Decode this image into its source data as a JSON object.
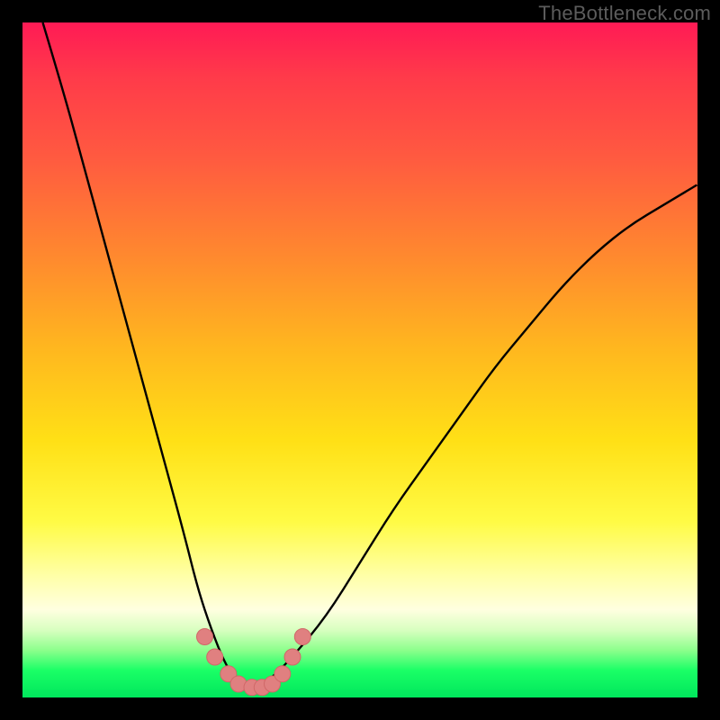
{
  "watermark": "TheBottleneck.com",
  "colors": {
    "frame": "#000000",
    "curve": "#000000",
    "marker_fill": "#e08080",
    "marker_stroke": "#d06868",
    "gradient_stops": [
      "#ff1a55",
      "#ff5a40",
      "#ffb61f",
      "#fffb45",
      "#ffffe0",
      "#1aff66"
    ]
  },
  "chart_data": {
    "type": "line",
    "title": "",
    "xlabel": "",
    "ylabel": "",
    "xlim": [
      0,
      100
    ],
    "ylim": [
      0,
      100
    ],
    "note": "x and y are percentages of the plot area (0 = left/bottom, 100 = right/top); the curve is a V-shaped bottleneck profile with minimum near x≈33",
    "series": [
      {
        "name": "bottleneck-curve",
        "x": [
          3,
          6,
          9,
          12,
          15,
          18,
          21,
          24,
          26,
          28,
          30,
          32,
          33,
          35,
          37,
          40,
          45,
          50,
          55,
          60,
          65,
          70,
          75,
          80,
          85,
          90,
          95,
          100
        ],
        "y": [
          100,
          90,
          79,
          68,
          57,
          46,
          35,
          24,
          16,
          10,
          5,
          2,
          1,
          1.5,
          3,
          6,
          12,
          20,
          28,
          35,
          42,
          49,
          55,
          61,
          66,
          70,
          73,
          76
        ]
      }
    ],
    "markers": {
      "name": "highlight-points",
      "note": "salmon dots clustered around the trough",
      "x": [
        27,
        28.5,
        30.5,
        32,
        34,
        35.5,
        37,
        38.5,
        40,
        41.5
      ],
      "y": [
        9,
        6,
        3.5,
        2,
        1.5,
        1.5,
        2,
        3.5,
        6,
        9
      ]
    }
  }
}
